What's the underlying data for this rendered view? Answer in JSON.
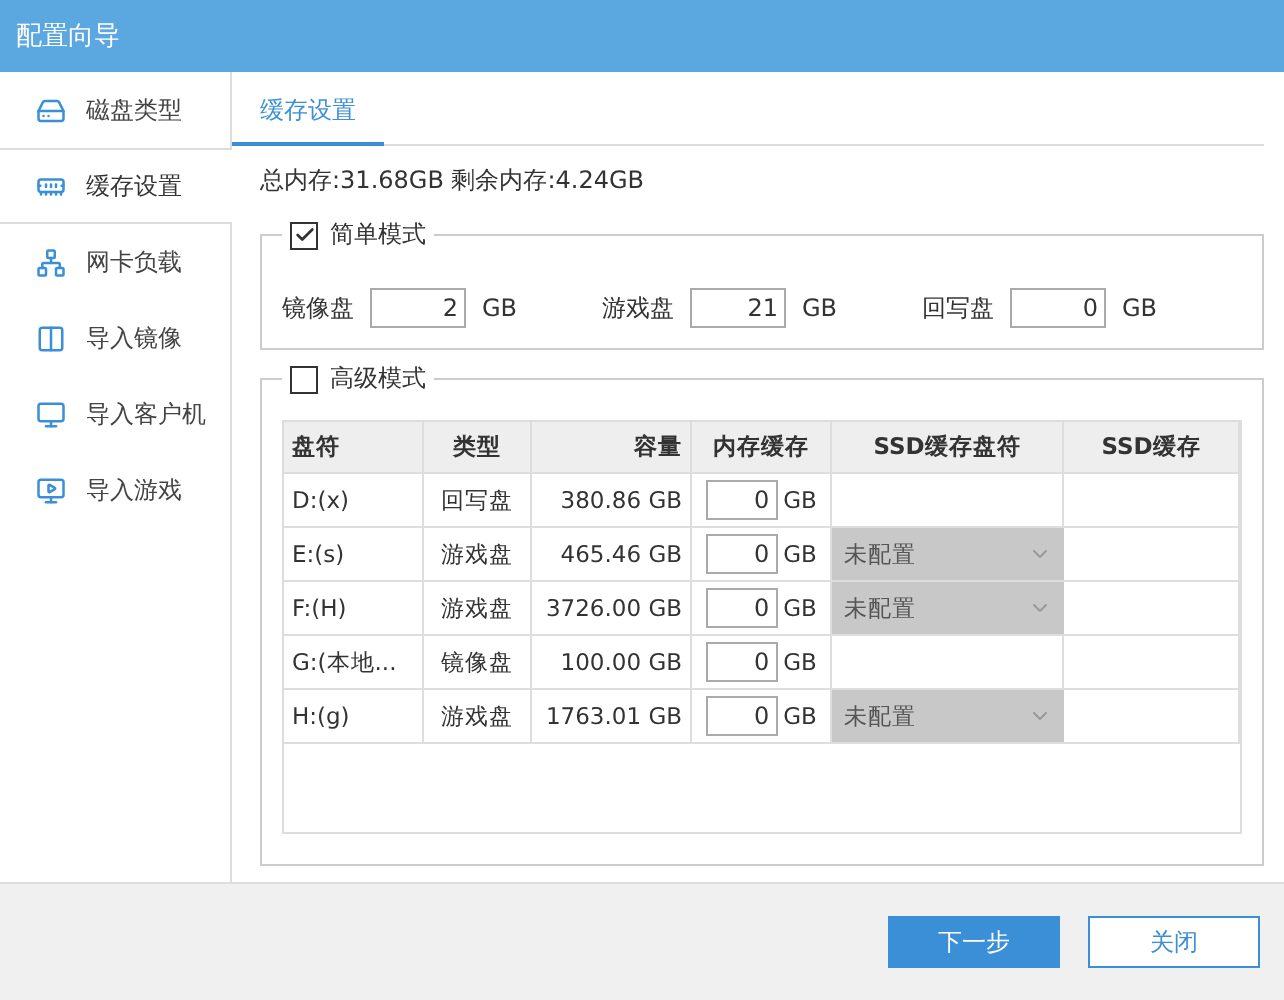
{
  "window": {
    "title": "配置向导"
  },
  "sidebar": {
    "items": [
      {
        "label": "磁盘类型",
        "selected": false
      },
      {
        "label": "缓存设置",
        "selected": true
      },
      {
        "label": "网卡负载",
        "selected": false
      },
      {
        "label": "导入镜像",
        "selected": false
      },
      {
        "label": "导入客户机",
        "selected": false
      },
      {
        "label": "导入游戏",
        "selected": false
      }
    ]
  },
  "tab": {
    "label": "缓存设置",
    "selected": true
  },
  "memory_info": "总内存:31.68GB 剩余内存:4.24GB",
  "simple_mode": {
    "label": "简单模式",
    "checked": true,
    "fields": [
      {
        "label": "镜像盘",
        "value": "2",
        "unit": "GB"
      },
      {
        "label": "游戏盘",
        "value": "21",
        "unit": "GB"
      },
      {
        "label": "回写盘",
        "value": "0",
        "unit": "GB"
      }
    ]
  },
  "advanced_mode": {
    "label": "高级模式",
    "checked": false
  },
  "table": {
    "columns": [
      "盘符",
      "类型",
      "容量",
      "内存缓存",
      "SSD缓存盘符",
      "SSD缓存"
    ],
    "rows": [
      {
        "drive": "D:(x)",
        "type": "回写盘",
        "capacity": "380.86 GB",
        "cache": "0",
        "unit": "GB"
      },
      {
        "drive": "E:(s)",
        "type": "游戏盘",
        "capacity": "465.46 GB",
        "cache": "0",
        "unit": "GB",
        "ssd_select": "未配置"
      },
      {
        "drive": "F:(H)",
        "type": "游戏盘",
        "capacity": "3726.00 GB",
        "cache": "0",
        "unit": "GB",
        "ssd_select": "未配置"
      },
      {
        "drive": "G:(本地...",
        "type": "镜像盘",
        "capacity": "100.00 GB",
        "cache": "0",
        "unit": "GB"
      },
      {
        "drive": "H:(g)",
        "type": "游戏盘",
        "capacity": "1763.01 GB",
        "cache": "0",
        "unit": "GB",
        "ssd_select": "未配置"
      }
    ]
  },
  "buttons": [
    {
      "label": "下一步",
      "kind": "primary"
    },
    {
      "label": "关闭",
      "kind": "secondary"
    }
  ]
}
